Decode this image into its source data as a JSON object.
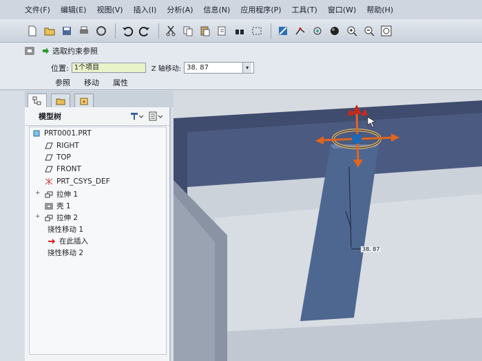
{
  "menubar": {
    "items": [
      "文件(F)",
      "编辑(E)",
      "视图(V)",
      "插入(I)",
      "分析(A)",
      "信息(N)",
      "应用程序(P)",
      "工具(T)",
      "窗口(W)",
      "帮助(H)"
    ]
  },
  "toolbar": {
    "icons": [
      "new-icon",
      "open-icon",
      "save-icon",
      "print-icon",
      "email-icon",
      "undo-icon",
      "redo-icon",
      "cut-icon",
      "copy-icon",
      "paste-icon",
      "regenerate-icon",
      "find-icon",
      "select-box-icon",
      "repaint-icon",
      "spin-center-icon",
      "orient-icon",
      "display-style-icon",
      "zoom-in-icon",
      "zoom-out-icon",
      "refit-icon"
    ]
  },
  "dashboard": {
    "title": "选取约束参照",
    "position_label": "位置:",
    "position_value": "1个项目",
    "axis_label": "Z 轴移动:",
    "axis_value": "38. 87",
    "tabs": [
      "参照",
      "移动",
      "属性"
    ]
  },
  "model_tree": {
    "title": "模型树",
    "root": "PRT0001.PRT",
    "items": [
      {
        "label": "RIGHT",
        "icon": "datum-plane-icon",
        "expandable": false
      },
      {
        "label": "TOP",
        "icon": "datum-plane-icon",
        "expandable": false
      },
      {
        "label": "FRONT",
        "icon": "datum-plane-icon",
        "expandable": false
      },
      {
        "label": "PRT_CSYS_DEF",
        "icon": "csys-icon",
        "expandable": false
      },
      {
        "label": "拉伸 1",
        "icon": "extrude-icon",
        "expandable": true
      },
      {
        "label": "壳 1",
        "icon": "shell-icon",
        "expandable": false
      },
      {
        "label": "拉伸 2",
        "icon": "extrude-icon",
        "expandable": true
      },
      {
        "label": "挠性移动 1",
        "icon": "",
        "expandable": false
      },
      {
        "label": "在此插入",
        "icon": "insert-arrow-icon",
        "expandable": false
      },
      {
        "label": "挠性移动 2",
        "icon": "",
        "expandable": false
      }
    ]
  },
  "viewport": {
    "dimension_value": "38. 87"
  },
  "colors": {
    "accent_blue": "#1a6ab8",
    "dragger_orange": "#e0651e",
    "dragger_red": "#c42a1b",
    "insert_arrow": "#d02020"
  }
}
